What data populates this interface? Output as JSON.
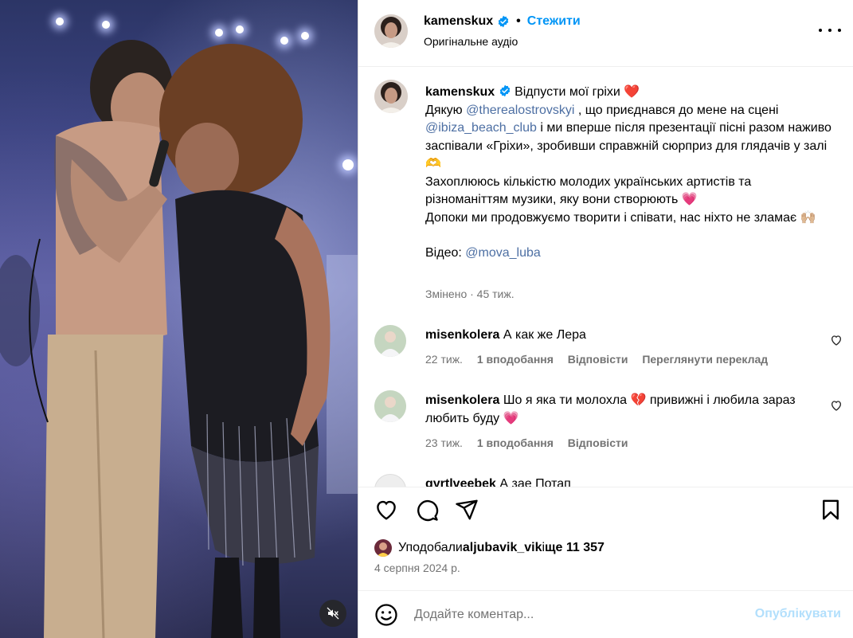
{
  "post": {
    "username": "kamenskux",
    "follow_label": "Стежити",
    "separator": "•",
    "audio": "Оригінальне аудіо"
  },
  "caption": {
    "username": "kamenskux",
    "title": "Відпусти мої гріхи ❤️",
    "line_thanks": "Дякую ",
    "mention_1": "@therealostrovskyi",
    "line_joined": " , що приєднався до мене на сцені",
    "mention_2": "@ibiza_beach_club",
    "line_sang": " і ми вперше після презентації пісні разом наживо заспівали «Гріхи», зробивши справжній сюрприз для глядачів у залі 🫶",
    "line_admire": "Захоплююсь кількістю молодих українських артистів та різноманіттям музики, яку вони створюють 💗",
    "line_continue": "Допоки ми продовжуємо творити і співати, нас ніхто не зламає 🙌🏼",
    "video_label": "Відео: ",
    "mention_3": "@mova_luba",
    "edited": "Змінено",
    "time_ago": " · 45 тиж."
  },
  "comments": [
    {
      "username": "misenkolera",
      "text": "А как же Лера",
      "time": "22 тиж.",
      "likes": "1 вподобання",
      "reply": "Відповісти",
      "translate": "Переглянути переклад"
    },
    {
      "username": "misenkolera",
      "text": "Шо я яка ти молохла 💔 привижні і любила зараз любить буду 💗",
      "time": "23 тиж.",
      "likes": "1 вподобання",
      "reply": "Відповісти"
    },
    {
      "username": "gyrtlveebek",
      "text": "А зае Потап"
    }
  ],
  "likes": {
    "prefix": "Уподобали ",
    "user": "aljubavik_vik",
    "and": " і ",
    "count": "ще 11 357"
  },
  "date": "4 серпня 2024 р.",
  "comment_box": {
    "placeholder": "Додайте коментар...",
    "publish": "Опублікувати"
  },
  "icons": {
    "like": "heart-icon",
    "comment": "comment-icon",
    "share": "send-icon",
    "save": "bookmark-icon",
    "emoji": "emoji-icon",
    "mute": "speaker-muted-icon"
  },
  "colors": {
    "link": "#0095f6",
    "mention": "#4d6fa3",
    "muted": "#737373",
    "publish_disabled": "#b2dffc"
  }
}
